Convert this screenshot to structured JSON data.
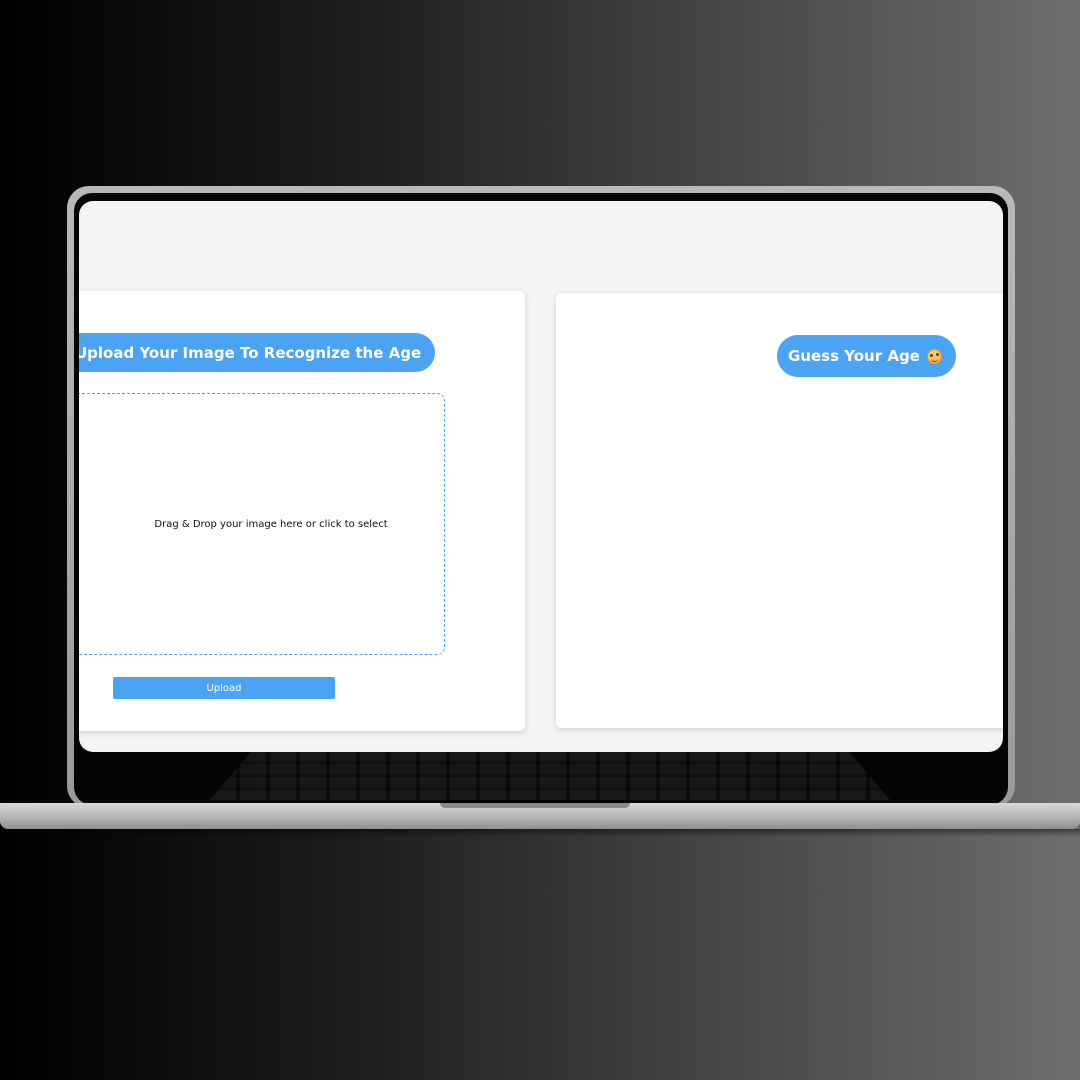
{
  "app": {
    "upload_title": "Upload Your Image To Recognize the Age",
    "dropzone_text": "Drag & Drop your image here or click to select",
    "upload_button_label": "Upload",
    "guess_title": "Guess Your Age",
    "guess_icon": "smiling-face-icon"
  },
  "colors": {
    "accent": "#4aa3f3",
    "screen_background": "#f4f4f4",
    "card_background": "#ffffff"
  }
}
